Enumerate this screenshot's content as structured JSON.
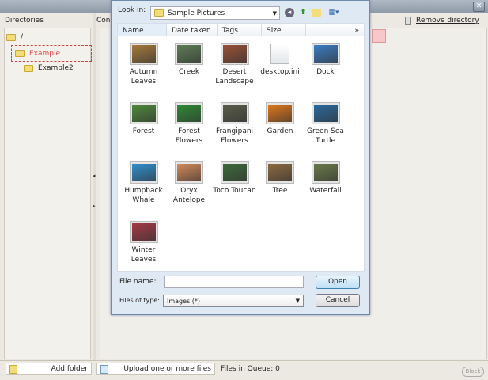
{
  "window": {
    "close_icon": "close-icon"
  },
  "left": {
    "header": "Directories",
    "tree": [
      {
        "label": "/",
        "depth": 0
      },
      {
        "label": "Example",
        "depth": 1,
        "selected": true
      },
      {
        "label": "Example2",
        "depth": 2
      }
    ]
  },
  "right": {
    "header": "Con",
    "remove_directory": "Remove directory"
  },
  "bottom": {
    "add_folder": "Add folder",
    "upload": "Upload one or more files",
    "queue": "Files in Queue: 0",
    "block": "Block"
  },
  "dialog": {
    "look_in_label": "Look in:",
    "look_in_value": "Sample Pictures",
    "columns": [
      "Name",
      "Date taken",
      "Tags",
      "Size",
      "»"
    ],
    "files": [
      {
        "name": "Autumn Leaves",
        "color": "#a57a3a"
      },
      {
        "name": "Creek",
        "color": "#5d7d55"
      },
      {
        "name": "Desert Landscape",
        "color": "#9a5037"
      },
      {
        "name": "desktop.ini",
        "color": "#e6eaef",
        "doc": true
      },
      {
        "name": "Dock",
        "color": "#3b7cc4"
      },
      {
        "name": "Forest",
        "color": "#4d8a3a"
      },
      {
        "name": "Forest Flowers",
        "color": "#2f8a35"
      },
      {
        "name": "Frangipani Flowers",
        "color": "#5b5d4a"
      },
      {
        "name": "Garden",
        "color": "#e0781a"
      },
      {
        "name": "Green Sea Turtle",
        "color": "#2a6aa0"
      },
      {
        "name": "Humpback Whale",
        "color": "#2f8fd0"
      },
      {
        "name": "Oryx Antelope",
        "color": "#d48a5a"
      },
      {
        "name": "Toco Toucan",
        "color": "#3c6a3a"
      },
      {
        "name": "Tree",
        "color": "#8c6a40"
      },
      {
        "name": "Waterfall",
        "color": "#6a7a4a"
      },
      {
        "name": "Winter Leaves",
        "color": "#a33a45"
      }
    ],
    "file_name_label": "File name:",
    "file_name_value": "",
    "files_of_type_label": "Files of type:",
    "files_of_type_value": "Images (*)",
    "open": "Open",
    "cancel": "Cancel"
  }
}
